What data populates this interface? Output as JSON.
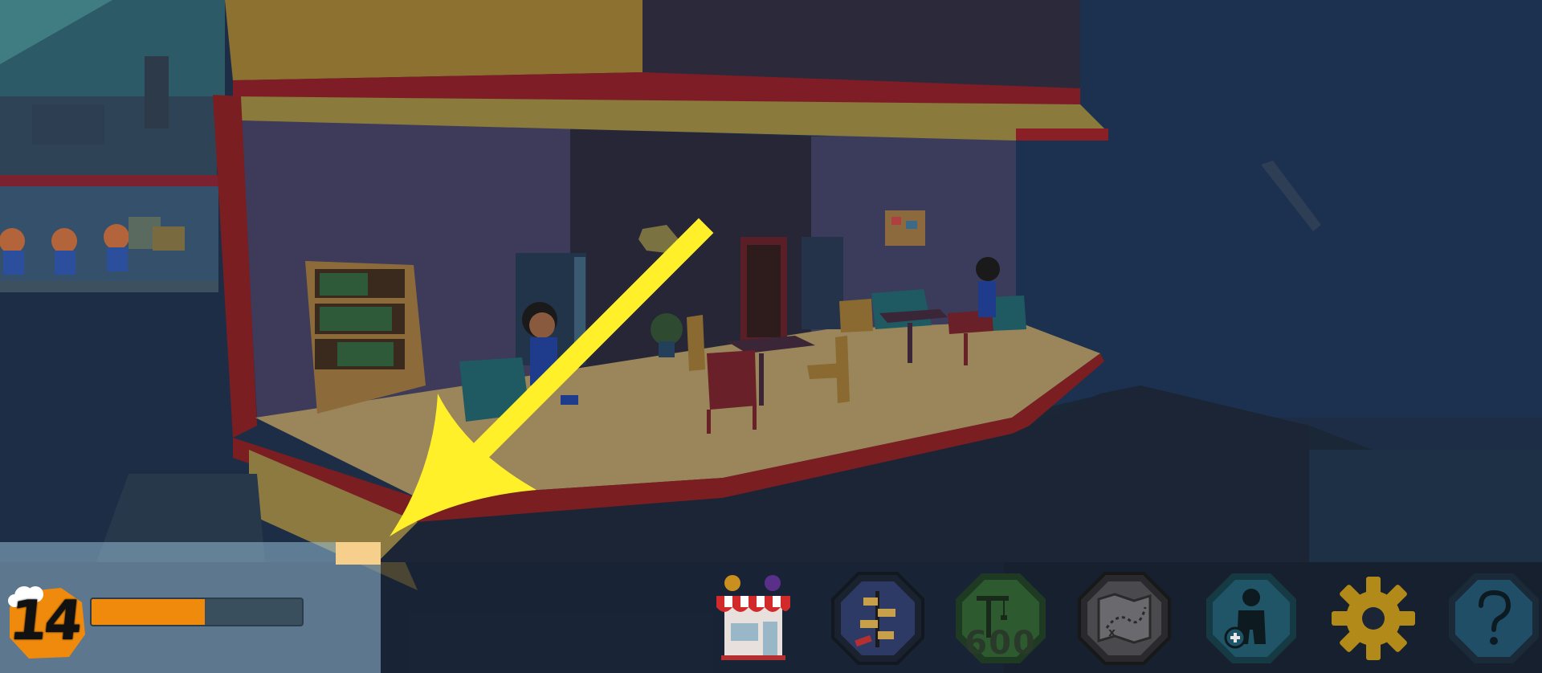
{
  "hud": {
    "level": "14",
    "xp_progress": 0.54,
    "buttons": {
      "shop": {
        "icon": "shop-icon"
      },
      "tasks": {
        "icon": "task-board-icon"
      },
      "build": {
        "icon": "crane-icon",
        "cost": "600"
      },
      "map": {
        "icon": "treasure-map-icon"
      },
      "hire": {
        "icon": "add-worker-icon"
      },
      "settings": {
        "icon": "gear-icon"
      },
      "help": {
        "icon": "question-mark-icon"
      }
    }
  },
  "colors": {
    "xp_fill": "#f08a0c",
    "tutorial_arrow": "#fff02a",
    "room_frame": "#7a1e22",
    "room_floor": "#a8935a"
  }
}
